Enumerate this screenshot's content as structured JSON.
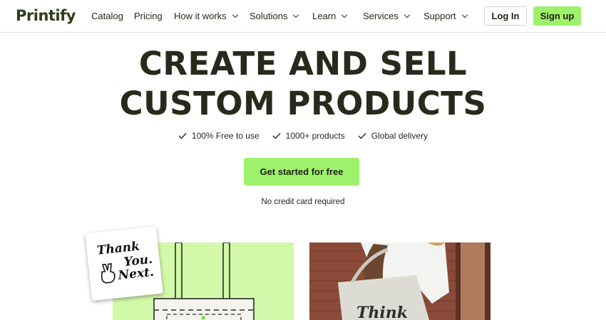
{
  "brand": {
    "logo_text": "Printify"
  },
  "nav": {
    "items": [
      {
        "label": "Catalog",
        "has_dropdown": false
      },
      {
        "label": "Pricing",
        "has_dropdown": false
      },
      {
        "label": "How it works",
        "has_dropdown": true
      },
      {
        "label": "Solutions",
        "has_dropdown": true
      },
      {
        "label": "Learn",
        "has_dropdown": true
      },
      {
        "label": "Services",
        "has_dropdown": true
      },
      {
        "label": "Support",
        "has_dropdown": true
      }
    ],
    "login_label": "Log In",
    "signup_label": "Sign up"
  },
  "hero": {
    "headline_line1": "CREATE AND SELL",
    "headline_line2": "CUSTOM PRODUCTS",
    "features": [
      "100% Free to use",
      "1000+ products",
      "Global delivery"
    ],
    "cta_label": "Get started for free",
    "cta_note": "No credit card required"
  },
  "showcase": {
    "sticker_lines": [
      "Thank",
      "You.",
      "Next."
    ],
    "photo_print_text": "Think"
  },
  "colors": {
    "accent_green": "#9ef26b",
    "light_green": "#d2f9a9",
    "logo_dark_green": "#2f3d16",
    "headline": "#29291c"
  }
}
